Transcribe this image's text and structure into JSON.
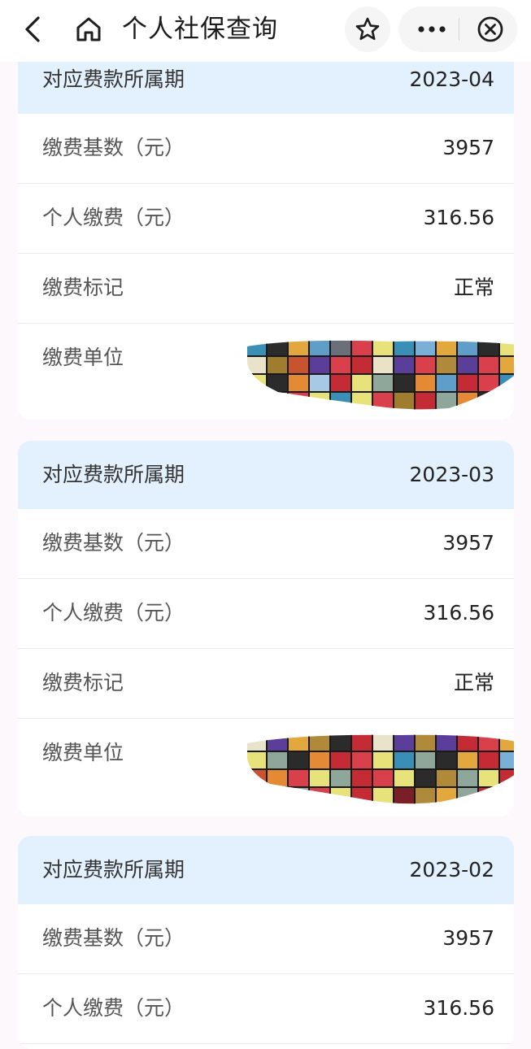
{
  "header": {
    "title": "个人社保查询",
    "icons": [
      "back-arrow-icon",
      "home-icon",
      "star-icon",
      "more-dots-icon",
      "close-circle-icon"
    ]
  },
  "labels": {
    "period": "对应费款所属期",
    "base": "缴费基数（元）",
    "personal": "个人缴费（元）",
    "mark": "缴费标记",
    "unit": "缴费单位"
  },
  "records": [
    {
      "period": "2023-04",
      "base": "3957",
      "personal": "316.56",
      "mark": "正常"
    },
    {
      "period": "2023-03",
      "base": "3957",
      "personal": "316.56",
      "mark": "正常"
    },
    {
      "period": "2023-02",
      "base": "3957",
      "personal": "316.56"
    }
  ],
  "colors": {
    "header_bg": "#e3f0fd",
    "page_bg": "#fcf8fb",
    "card_bg": "#ffffff"
  }
}
